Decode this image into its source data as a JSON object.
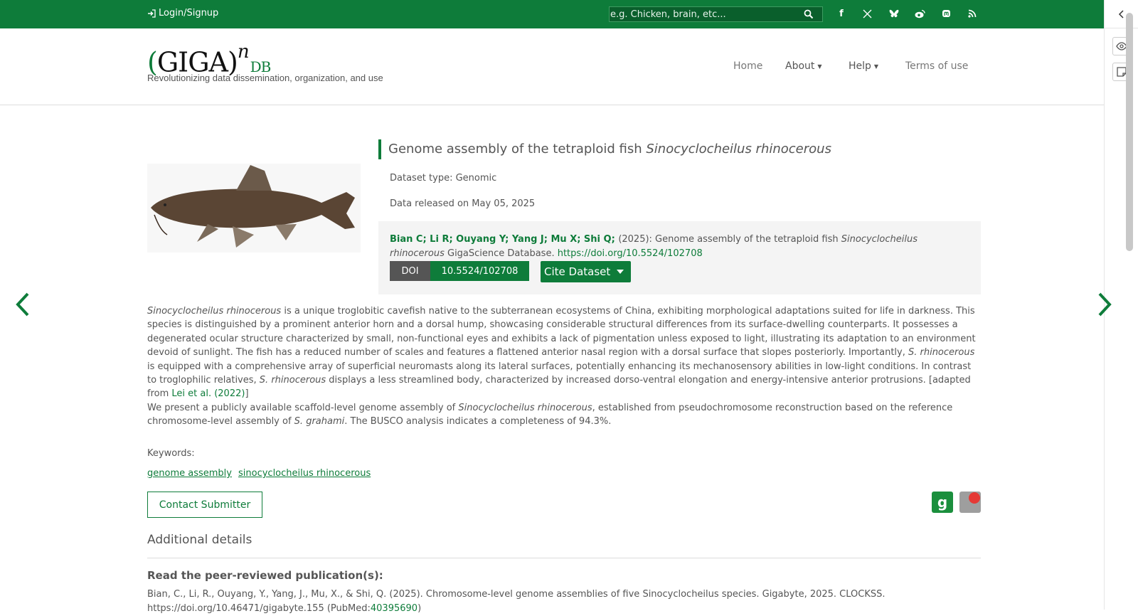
{
  "topbar": {
    "login_label": "Login/Signup",
    "search_placeholder": "e.g. Chicken, brain, etc...",
    "social_icons": [
      "facebook-icon",
      "x-icon",
      "bluesky-icon",
      "weibo-icon",
      "mastodon-icon",
      "rss-icon"
    ],
    "accent_color": "#0e7c3a"
  },
  "header": {
    "logo_giga": "GIGA",
    "logo_n": "n",
    "logo_db": "DB",
    "tagline": "Revolutionizing data dissemination, organization, and use",
    "nav": {
      "home": "Home",
      "about": "About",
      "help": "Help",
      "terms": "Terms of use"
    }
  },
  "dataset": {
    "title_prefix": "Genome assembly of the tetraploid fish ",
    "title_species": "Sinocyclocheilus rhinocerous",
    "type_line": "Dataset type: Genomic",
    "released_line": "Data released on May 05, 2025",
    "citation": {
      "authors": "Bian C; Li R; Ouyang Y; Yang J; Mu X; Shi Q; ",
      "year_part": "(2025): Genome assembly of the tetraploid fish ",
      "species": "Sinocyclocheilus rhinocerous",
      "source": " GigaScience Database. ",
      "doi_url": "https://doi.org/10.5524/102708"
    },
    "doi_label": "DOI",
    "doi_value": "10.5524/102708",
    "cite_button": "Cite Dataset"
  },
  "description": {
    "p1_species": "Sinocyclocheilus rhinocerous",
    "p1_a": " is a unique troglobitic cavefish native to the subterranean ecosystems of China, exhibiting morphological adaptations suited for life in darkness. This species is distinguished by a prominent anterior horn and a dorsal hump, showcasing considerable structural differences from its surface-dwelling counterparts. It possesses a degenerated ocular structure characterized by small, non-functional eyes and exhibits a lack of pigmentation unless exposed to light, illustrating its adaptation to an environment devoid of sunlight. The fish has a reduced number of scales and features a flattened anterior nasal region with a dorsal surface that slopes posteriorly. Importantly, ",
    "p1_s1": "S. rhinocerous",
    "p1_b": " is equipped with a comprehensive array of superficial neuromasts along its lateral surfaces, potentially enhancing its mechanosensory abilities in low-light conditions. In contrast to troglophilic relatives, ",
    "p1_s2": "S. rhinocerous",
    "p1_c": " displays a less streamlined body, characterized by increased dorso-ventral elongation and energy-intensive anterior protrusions. [adapted from ",
    "p1_link": "Lei et al. (2022)",
    "p1_end": "]",
    "p2_a": "We present a publicly available scaffold-level genome assembly of ",
    "p2_species": "Sinocyclocheilus rhinocerous",
    "p2_b": ", established from pseudochromosome reconstruction based on the reference chromosome-level assembly of ",
    "p2_s": "S. grahami",
    "p2_c": ". The BUSCO analysis indicates a completeness of 94.3%."
  },
  "keywords": {
    "label": "Keywords:",
    "items": [
      "genome assembly",
      "sinocyclocheilus rhinocerous"
    ]
  },
  "contact_button": "Contact Submitter",
  "additional": {
    "heading": "Additional details",
    "pub_heading": "Read the peer-reviewed publication(s):",
    "pub_text": "Bian, C., Li, R., Ouyang, Y., Yang, J., Mu, X., & Shi, Q. (2025). Chromosome-level genome assemblies of five Sinocyclocheilus species. Gigabyte, 2025. CLOCKSS.",
    "pub_doi": "https://doi.org/10.46471/gigabyte.155 (PubMed:",
    "pub_pmid": "40395690",
    "pub_end": ")"
  }
}
